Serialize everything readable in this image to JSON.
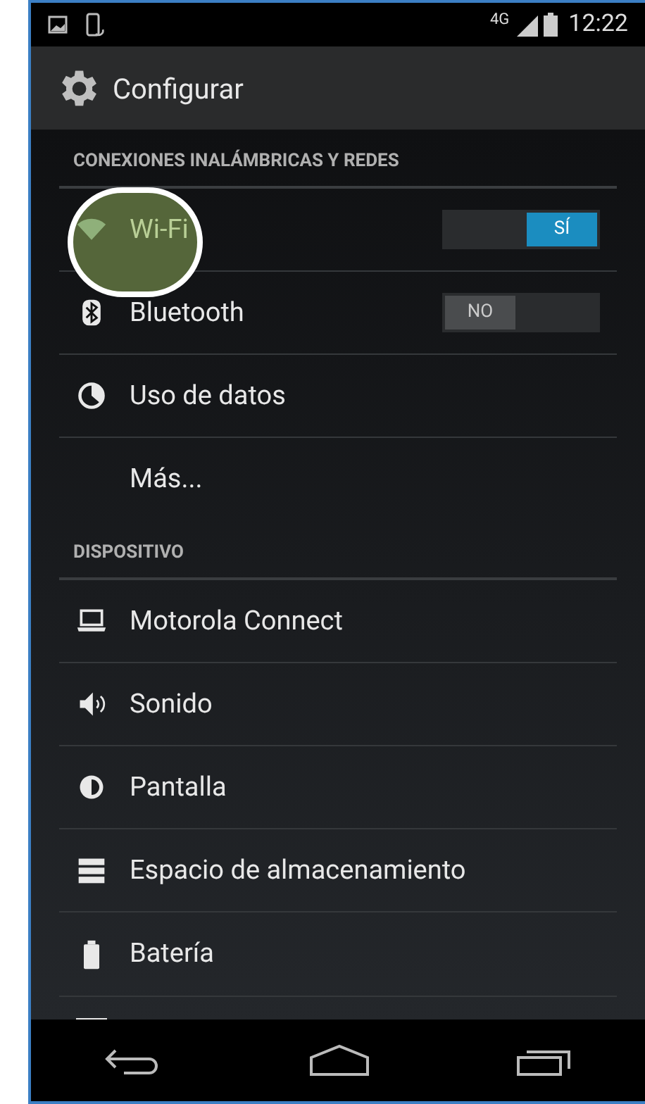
{
  "status_bar": {
    "network": "4G",
    "time": "12:22"
  },
  "action_bar": {
    "title": "Configurar"
  },
  "sections": [
    {
      "header": "CONEXIONES INALÁMBRICAS Y REDES",
      "items": [
        {
          "kind": "toggle",
          "label": "Wi-Fi",
          "on": true,
          "switch_text": "SÍ",
          "highlighted": true
        },
        {
          "kind": "toggle",
          "label": "Bluetooth",
          "on": false,
          "switch_text": "NO",
          "highlighted": false
        },
        {
          "kind": "plain",
          "label": "Uso de datos"
        },
        {
          "kind": "plain",
          "label": "Más..."
        }
      ]
    },
    {
      "header": "DISPOSITIVO",
      "items": [
        {
          "kind": "plain",
          "label": "Motorola Connect"
        },
        {
          "kind": "plain",
          "label": "Sonido"
        },
        {
          "kind": "plain",
          "label": "Pantalla"
        },
        {
          "kind": "plain",
          "label": "Espacio de almacenamiento"
        },
        {
          "kind": "plain",
          "label": "Batería"
        }
      ]
    }
  ]
}
